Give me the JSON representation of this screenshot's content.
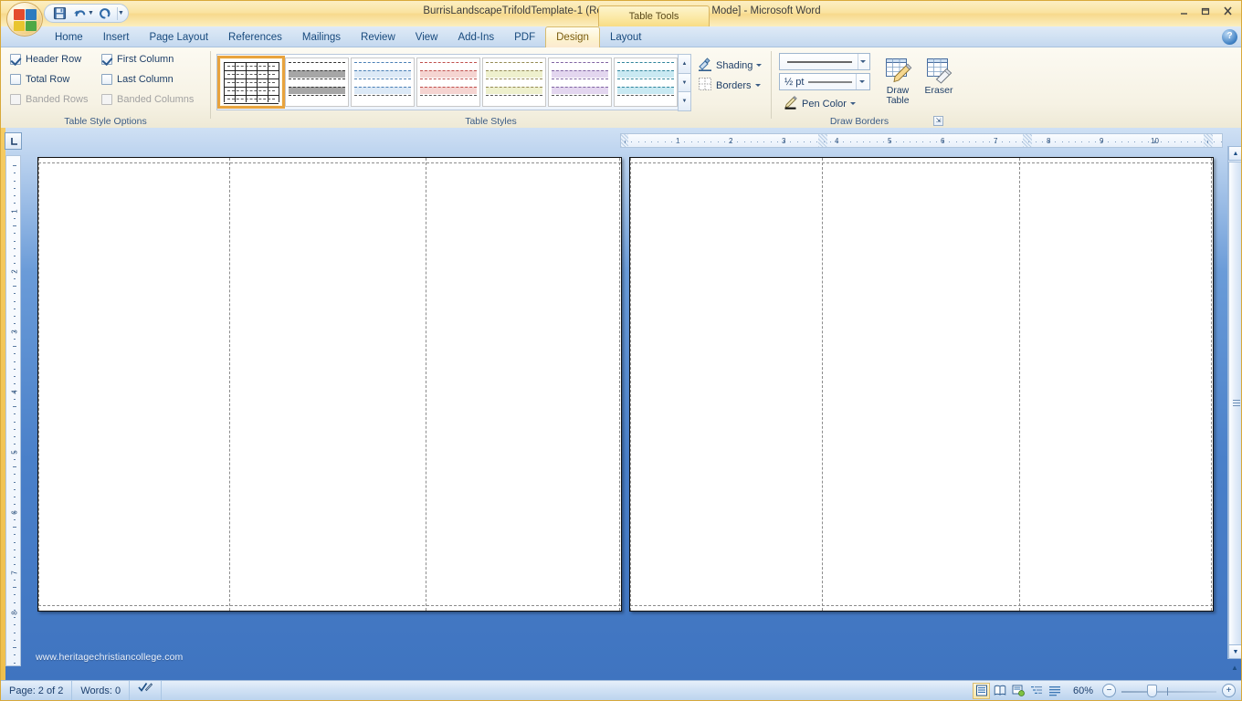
{
  "window": {
    "title": "BurrisLandscapeTrifoldTemplate-1 (Read-Only) [Compatibility Mode] - Microsoft Word",
    "contextual_tab_title": "Table Tools",
    "minimize": "–",
    "restore": "❐",
    "close": "✕",
    "help": "?"
  },
  "quick_access": {
    "items": [
      {
        "name": "save",
        "label": "Save",
        "icon": "save-icon"
      },
      {
        "name": "undo",
        "label": "Undo",
        "icon": "undo-icon"
      },
      {
        "name": "redo",
        "label": "Redo",
        "icon": "redo-icon"
      },
      {
        "name": "customize",
        "label": "Customize Quick Access Toolbar",
        "icon": "chevron-down-icon"
      }
    ]
  },
  "tabs": [
    {
      "label": "Home",
      "active": false
    },
    {
      "label": "Insert",
      "active": false
    },
    {
      "label": "Page Layout",
      "active": false
    },
    {
      "label": "References",
      "active": false
    },
    {
      "label": "Mailings",
      "active": false
    },
    {
      "label": "Review",
      "active": false
    },
    {
      "label": "View",
      "active": false
    },
    {
      "label": "Add-Ins",
      "active": false
    },
    {
      "label": "PDF",
      "active": false
    },
    {
      "label": "Design",
      "active": true
    },
    {
      "label": "Layout",
      "active": false
    }
  ],
  "ribbon": {
    "groups": [
      {
        "name": "table-style-options",
        "label": "Table Style Options"
      },
      {
        "name": "table-styles",
        "label": "Table Styles"
      },
      {
        "name": "draw-borders",
        "label": "Draw Borders"
      }
    ],
    "table_style_options": {
      "checkboxes": [
        {
          "label": "Header Row",
          "checked": true,
          "enabled": true
        },
        {
          "label": "First Column",
          "checked": true,
          "enabled": true
        },
        {
          "label": "Total Row",
          "checked": false,
          "enabled": true
        },
        {
          "label": "Last Column",
          "checked": false,
          "enabled": true
        },
        {
          "label": "Banded Rows",
          "checked": false,
          "enabled": false
        },
        {
          "label": "Banded Columns",
          "checked": false,
          "enabled": false
        }
      ]
    },
    "table_styles": {
      "selected_index": 0,
      "thumbnails": [
        {
          "name": "table-grid",
          "accent": "#222222",
          "type": "grid"
        },
        {
          "name": "light-shading-gray",
          "accent": "#a6a6a6",
          "type": "banded"
        },
        {
          "name": "light-shading-blue",
          "accent": "#cfe0f0",
          "type": "banded"
        },
        {
          "name": "light-shading-red",
          "accent": "#f3c5c2",
          "type": "banded"
        },
        {
          "name": "light-shading-olive",
          "accent": "#e8eec0",
          "type": "banded"
        },
        {
          "name": "light-shading-purple",
          "accent": "#ddcdea",
          "type": "banded"
        },
        {
          "name": "light-shading-aqua",
          "accent": "#bfe6f0",
          "type": "banded"
        }
      ],
      "scroll_up": "▲",
      "scroll_down": "▼",
      "more": "▼"
    },
    "shading_label": "Shading",
    "borders_label": "Borders",
    "line_style_value": "",
    "line_weight_value": "½ pt",
    "pen_color_label": "Pen Color",
    "draw_table_label": "Draw\nTable",
    "draw_table_line1": "Draw",
    "draw_table_line2": "Table",
    "eraser_label": "Eraser",
    "dialog_launcher": "⇲"
  },
  "rulers": {
    "tab_selector": "L",
    "horizontal_ticks": [
      "1",
      "2",
      "3",
      "4",
      "5",
      "6",
      "7",
      "8",
      "9",
      "10"
    ],
    "vertical_ticks": [
      "1",
      "2",
      "3",
      "4",
      "5",
      "6",
      "7",
      "8"
    ]
  },
  "document": {
    "watermark": "www.heritagechristiancollege.com",
    "pages": [
      {
        "name": "page-left",
        "panels": 3
      },
      {
        "name": "page-right",
        "panels": 3
      }
    ]
  },
  "status_bar": {
    "page_label": "Page: 2 of 2",
    "words_label": "Words: 0",
    "proofing_icon": "spell-check-icon",
    "zoom_level": "60%",
    "zoom_out": "−",
    "zoom_in": "+",
    "views": [
      {
        "name": "print-layout",
        "active": true,
        "icon": "print-layout-icon"
      },
      {
        "name": "full-screen",
        "active": false,
        "icon": "full-screen-icon"
      },
      {
        "name": "web-layout",
        "active": false,
        "icon": "web-layout-icon"
      },
      {
        "name": "outline",
        "active": false,
        "icon": "outline-icon"
      },
      {
        "name": "draft",
        "active": false,
        "icon": "draft-icon"
      }
    ]
  },
  "scrollbar": {
    "up": "▲",
    "down": "▼",
    "prev_page": "▲",
    "select_browse_object": "○",
    "next_page": "▼"
  }
}
